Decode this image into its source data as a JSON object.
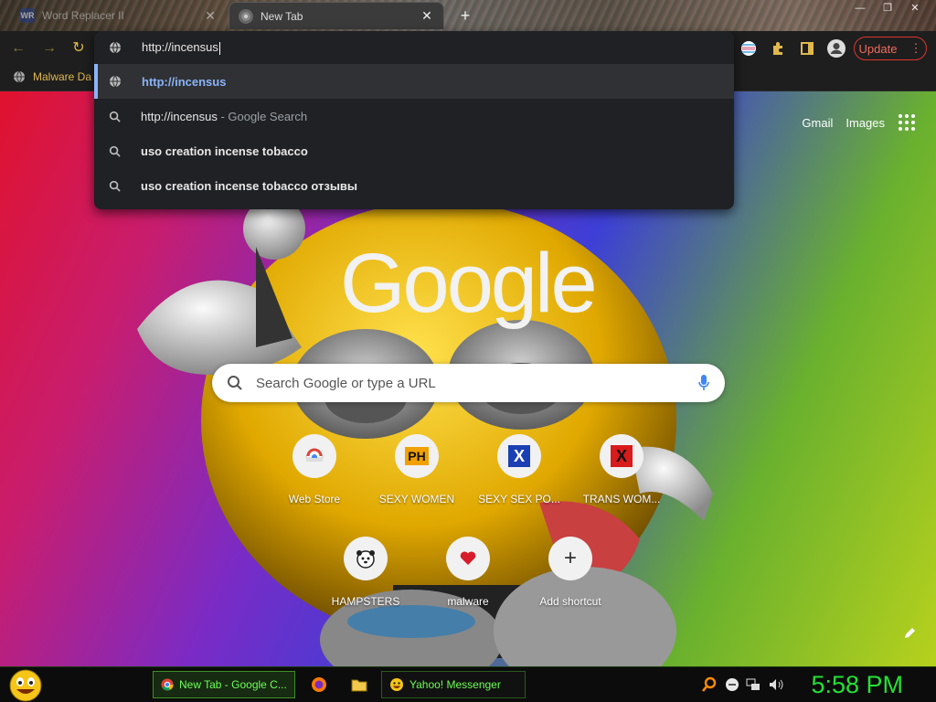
{
  "tabs": [
    {
      "title": "Word Replacer II",
      "favicon": "WR",
      "active": false
    },
    {
      "title": "New Tab",
      "active": true
    }
  ],
  "window_controls": [
    "—",
    "❐",
    "✕"
  ],
  "toolbar": {
    "update_label": "Update"
  },
  "bookmarks": [
    {
      "label": "Malware Da"
    }
  ],
  "omnibox": {
    "input_text": "http://incensus",
    "suggestions": [
      {
        "text": "http://incensus",
        "kind": "url",
        "selected": true
      },
      {
        "text": "http://incensus",
        "suffix": " - Google Search",
        "kind": "search"
      },
      {
        "text": "uso creation incense tobacco",
        "kind": "search-bold"
      },
      {
        "text": "uso creation incense tobacco отзывы",
        "kind": "search-bold"
      }
    ]
  },
  "ntp": {
    "gmail": "Gmail",
    "images": "Images",
    "logo": "Google",
    "search_placeholder": "Search Google or type a URL",
    "shortcuts": [
      {
        "label": "Web Store",
        "icon": "chrome-store-icon"
      },
      {
        "label": "SEXY WOMEN",
        "icon": "ph-icon",
        "badge": "PH"
      },
      {
        "label": "SEXY SEX PO...",
        "icon": "x-blue-icon",
        "badge": "X"
      },
      {
        "label": "TRANS WOM...",
        "icon": "x-red-icon",
        "badge": "X"
      },
      {
        "label": "HAMPSTERS",
        "icon": "hamster-icon"
      },
      {
        "label": "malware",
        "icon": "heart-icon"
      },
      {
        "label": "Add shortcut",
        "icon": "plus-icon"
      }
    ]
  },
  "taskbar": {
    "tasks": [
      {
        "label": "New Tab - Google C...",
        "active": true
      },
      {
        "label": "Yahoo! Messenger",
        "active": false
      }
    ],
    "clock": "5:58 PM"
  },
  "colors": {
    "omnibox_bg": "#202124",
    "link_blue": "#8ab4f8",
    "clock_green": "#24e036",
    "update_red": "#d9372f"
  }
}
